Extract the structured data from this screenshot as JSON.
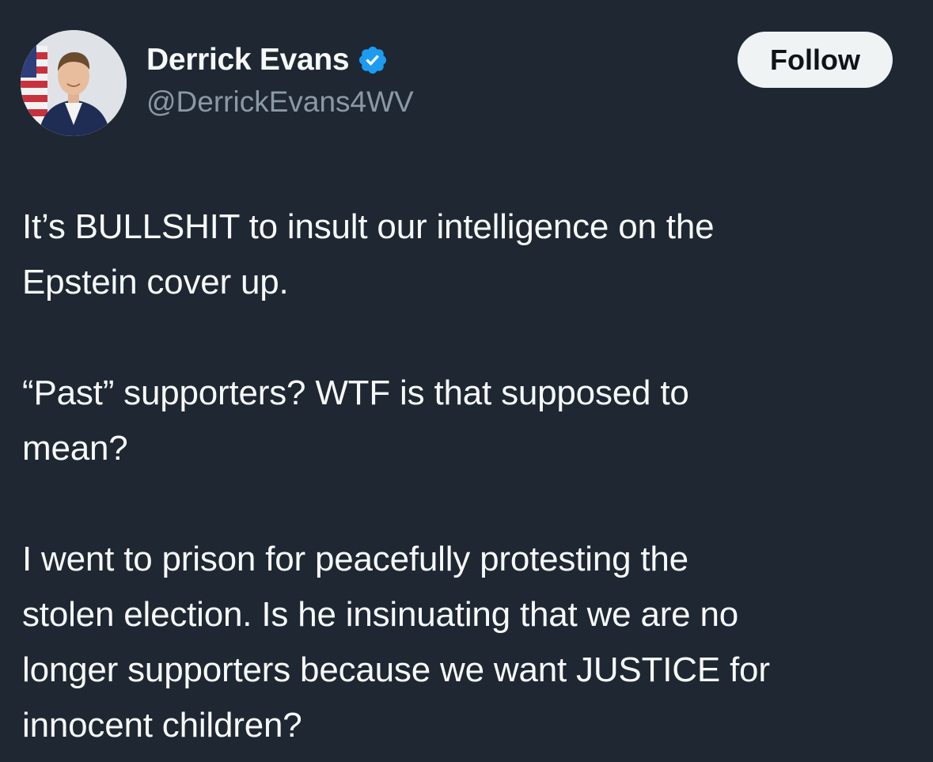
{
  "tweet": {
    "author": {
      "display_name": "Derrick Evans",
      "handle": "@DerrickEvans4WV",
      "verified": true,
      "verified_color": "#1d9bf0",
      "avatar_icon": "profile-photo"
    },
    "follow_label": "Follow",
    "paragraphs": [
      {
        "lines": [
          "It’s BULLSHIT to insult our intelligence on the",
          "Epstein cover up."
        ]
      },
      {
        "lines": [
          "“Past” supporters? WTF is that supposed to",
          "mean?"
        ]
      },
      {
        "lines": [
          "I went to prison for peacefully protesting the",
          "stolen election. Is he insinuating that we are no",
          "longer supporters because we want JUSTICE for",
          "innocent children?"
        ]
      }
    ]
  },
  "colors": {
    "background": "#1e2732",
    "text_primary": "#f7f9f9",
    "text_secondary": "#8b98a5",
    "button_bg": "#eff3f4",
    "button_text": "#0f1419"
  }
}
